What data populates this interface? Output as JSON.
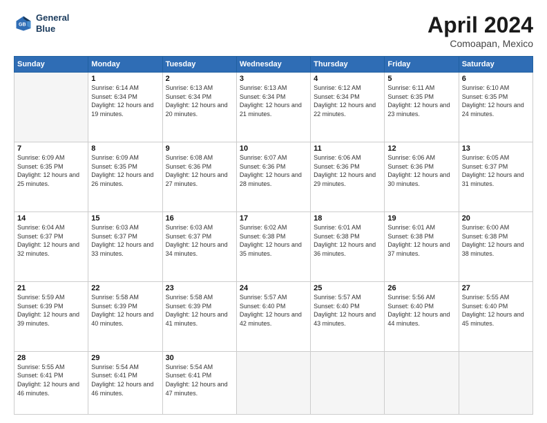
{
  "header": {
    "logo_line1": "General",
    "logo_line2": "Blue",
    "month_year": "April 2024",
    "location": "Comoapan, Mexico"
  },
  "days_of_week": [
    "Sunday",
    "Monday",
    "Tuesday",
    "Wednesday",
    "Thursday",
    "Friday",
    "Saturday"
  ],
  "weeks": [
    [
      {
        "day": "",
        "sunrise": "",
        "sunset": "",
        "daylight": ""
      },
      {
        "day": "1",
        "sunrise": "Sunrise: 6:14 AM",
        "sunset": "Sunset: 6:34 PM",
        "daylight": "Daylight: 12 hours and 19 minutes."
      },
      {
        "day": "2",
        "sunrise": "Sunrise: 6:13 AM",
        "sunset": "Sunset: 6:34 PM",
        "daylight": "Daylight: 12 hours and 20 minutes."
      },
      {
        "day": "3",
        "sunrise": "Sunrise: 6:13 AM",
        "sunset": "Sunset: 6:34 PM",
        "daylight": "Daylight: 12 hours and 21 minutes."
      },
      {
        "day": "4",
        "sunrise": "Sunrise: 6:12 AM",
        "sunset": "Sunset: 6:34 PM",
        "daylight": "Daylight: 12 hours and 22 minutes."
      },
      {
        "day": "5",
        "sunrise": "Sunrise: 6:11 AM",
        "sunset": "Sunset: 6:35 PM",
        "daylight": "Daylight: 12 hours and 23 minutes."
      },
      {
        "day": "6",
        "sunrise": "Sunrise: 6:10 AM",
        "sunset": "Sunset: 6:35 PM",
        "daylight": "Daylight: 12 hours and 24 minutes."
      }
    ],
    [
      {
        "day": "7",
        "sunrise": "Sunrise: 6:09 AM",
        "sunset": "Sunset: 6:35 PM",
        "daylight": "Daylight: 12 hours and 25 minutes."
      },
      {
        "day": "8",
        "sunrise": "Sunrise: 6:09 AM",
        "sunset": "Sunset: 6:35 PM",
        "daylight": "Daylight: 12 hours and 26 minutes."
      },
      {
        "day": "9",
        "sunrise": "Sunrise: 6:08 AM",
        "sunset": "Sunset: 6:36 PM",
        "daylight": "Daylight: 12 hours and 27 minutes."
      },
      {
        "day": "10",
        "sunrise": "Sunrise: 6:07 AM",
        "sunset": "Sunset: 6:36 PM",
        "daylight": "Daylight: 12 hours and 28 minutes."
      },
      {
        "day": "11",
        "sunrise": "Sunrise: 6:06 AM",
        "sunset": "Sunset: 6:36 PM",
        "daylight": "Daylight: 12 hours and 29 minutes."
      },
      {
        "day": "12",
        "sunrise": "Sunrise: 6:06 AM",
        "sunset": "Sunset: 6:36 PM",
        "daylight": "Daylight: 12 hours and 30 minutes."
      },
      {
        "day": "13",
        "sunrise": "Sunrise: 6:05 AM",
        "sunset": "Sunset: 6:37 PM",
        "daylight": "Daylight: 12 hours and 31 minutes."
      }
    ],
    [
      {
        "day": "14",
        "sunrise": "Sunrise: 6:04 AM",
        "sunset": "Sunset: 6:37 PM",
        "daylight": "Daylight: 12 hours and 32 minutes."
      },
      {
        "day": "15",
        "sunrise": "Sunrise: 6:03 AM",
        "sunset": "Sunset: 6:37 PM",
        "daylight": "Daylight: 12 hours and 33 minutes."
      },
      {
        "day": "16",
        "sunrise": "Sunrise: 6:03 AM",
        "sunset": "Sunset: 6:37 PM",
        "daylight": "Daylight: 12 hours and 34 minutes."
      },
      {
        "day": "17",
        "sunrise": "Sunrise: 6:02 AM",
        "sunset": "Sunset: 6:38 PM",
        "daylight": "Daylight: 12 hours and 35 minutes."
      },
      {
        "day": "18",
        "sunrise": "Sunrise: 6:01 AM",
        "sunset": "Sunset: 6:38 PM",
        "daylight": "Daylight: 12 hours and 36 minutes."
      },
      {
        "day": "19",
        "sunrise": "Sunrise: 6:01 AM",
        "sunset": "Sunset: 6:38 PM",
        "daylight": "Daylight: 12 hours and 37 minutes."
      },
      {
        "day": "20",
        "sunrise": "Sunrise: 6:00 AM",
        "sunset": "Sunset: 6:38 PM",
        "daylight": "Daylight: 12 hours and 38 minutes."
      }
    ],
    [
      {
        "day": "21",
        "sunrise": "Sunrise: 5:59 AM",
        "sunset": "Sunset: 6:39 PM",
        "daylight": "Daylight: 12 hours and 39 minutes."
      },
      {
        "day": "22",
        "sunrise": "Sunrise: 5:58 AM",
        "sunset": "Sunset: 6:39 PM",
        "daylight": "Daylight: 12 hours and 40 minutes."
      },
      {
        "day": "23",
        "sunrise": "Sunrise: 5:58 AM",
        "sunset": "Sunset: 6:39 PM",
        "daylight": "Daylight: 12 hours and 41 minutes."
      },
      {
        "day": "24",
        "sunrise": "Sunrise: 5:57 AM",
        "sunset": "Sunset: 6:40 PM",
        "daylight": "Daylight: 12 hours and 42 minutes."
      },
      {
        "day": "25",
        "sunrise": "Sunrise: 5:57 AM",
        "sunset": "Sunset: 6:40 PM",
        "daylight": "Daylight: 12 hours and 43 minutes."
      },
      {
        "day": "26",
        "sunrise": "Sunrise: 5:56 AM",
        "sunset": "Sunset: 6:40 PM",
        "daylight": "Daylight: 12 hours and 44 minutes."
      },
      {
        "day": "27",
        "sunrise": "Sunrise: 5:55 AM",
        "sunset": "Sunset: 6:40 PM",
        "daylight": "Daylight: 12 hours and 45 minutes."
      }
    ],
    [
      {
        "day": "28",
        "sunrise": "Sunrise: 5:55 AM",
        "sunset": "Sunset: 6:41 PM",
        "daylight": "Daylight: 12 hours and 46 minutes."
      },
      {
        "day": "29",
        "sunrise": "Sunrise: 5:54 AM",
        "sunset": "Sunset: 6:41 PM",
        "daylight": "Daylight: 12 hours and 46 minutes."
      },
      {
        "day": "30",
        "sunrise": "Sunrise: 5:54 AM",
        "sunset": "Sunset: 6:41 PM",
        "daylight": "Daylight: 12 hours and 47 minutes."
      },
      {
        "day": "",
        "sunrise": "",
        "sunset": "",
        "daylight": ""
      },
      {
        "day": "",
        "sunrise": "",
        "sunset": "",
        "daylight": ""
      },
      {
        "day": "",
        "sunrise": "",
        "sunset": "",
        "daylight": ""
      },
      {
        "day": "",
        "sunrise": "",
        "sunset": "",
        "daylight": ""
      }
    ]
  ]
}
